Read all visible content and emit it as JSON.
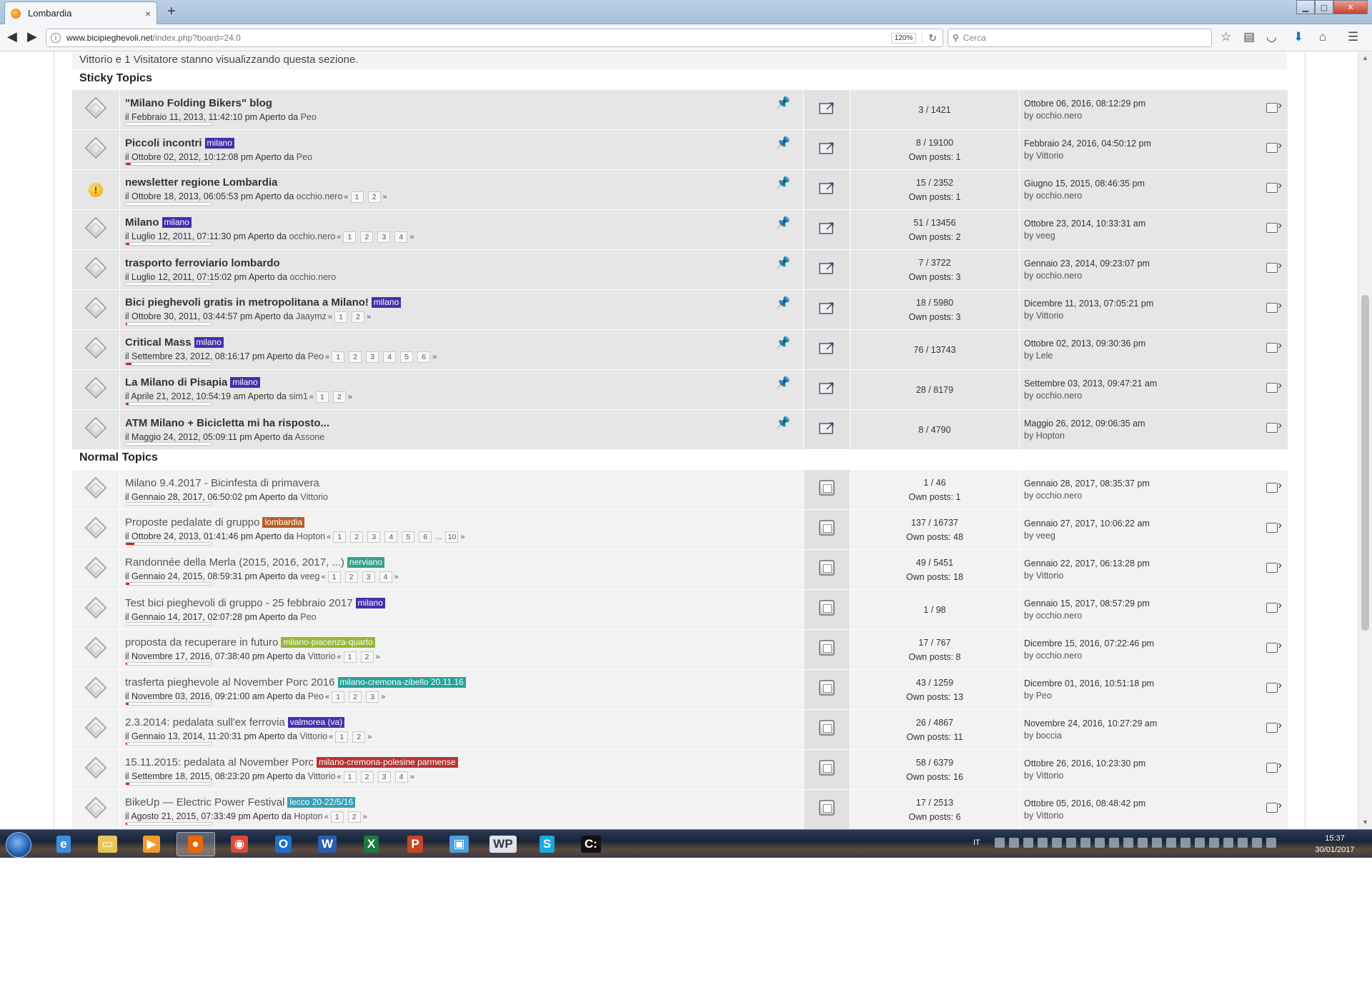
{
  "browser": {
    "tab_title": "Lombardia",
    "tab_close": "×",
    "new_tab": "+",
    "url_domain": "www.bicipieghevoli.net",
    "url_path": "/index.php?board=24.0",
    "zoom": "120%",
    "search_placeholder": "Cerca"
  },
  "viewers": "Vittorio e 1 Visitatore stanno visualizzando questa sezione.",
  "sticky_header": "Sticky Topics",
  "normal_header": "Normal Topics",
  "sticky": [
    {
      "title": "\"Milano Folding Bikers\" blog",
      "tag": "",
      "tag_color": "",
      "meta_date": "il Febbraio 11, 2013, 11:42:10 pm",
      "meta_opened": "Aperto da",
      "author": "Peo",
      "pages": [],
      "stats1": "3 / 1421",
      "stats2": "",
      "last_date": "Ottobre 06, 2016, 08:12:29 pm",
      "last_by": "by",
      "last_user": "occhio.nero",
      "progress": 0,
      "icon": "topic"
    },
    {
      "title": "Piccoli incontri",
      "tag": "milano",
      "tag_color": "#3a27a8",
      "meta_date": "il Ottobre 02, 2012, 10:12:08 pm",
      "meta_opened": "Aperto da",
      "author": "Peo",
      "pages": [],
      "stats1": "8 / 19100",
      "stats2": "Own posts: 1",
      "last_date": "Febbraio 24, 2016, 04:50:12 pm",
      "last_by": "by",
      "last_user": "Vittorio",
      "progress": 0.06,
      "icon": "topic"
    },
    {
      "title": "newsletter regione Lombardia",
      "tag": "",
      "tag_color": "",
      "meta_date": "il Ottobre 18, 2013, 06:05:53 pm",
      "meta_opened": "Aperto da",
      "author": "occhio.nero",
      "pages": [
        "1",
        "2"
      ],
      "stats1": "15 / 2352",
      "stats2": "Own posts: 1",
      "last_date": "Giugno 15, 2015, 08:46:35 pm",
      "last_by": "by",
      "last_user": "occhio.nero",
      "progress": 0,
      "icon": "warn"
    },
    {
      "title": "Milano",
      "tag": "milano",
      "tag_color": "#3a27a8",
      "meta_date": "il Luglio 12, 2011, 07:11:30 pm",
      "meta_opened": "Aperto da",
      "author": "occhio.nero",
      "pages": [
        "1",
        "2",
        "3",
        "4"
      ],
      "stats1": "51 / 13456",
      "stats2": "Own posts: 2",
      "last_date": "Ottobre 23, 2014, 10:33:31 am",
      "last_by": "by",
      "last_user": "veeg",
      "progress": 0.04,
      "icon": "topic"
    },
    {
      "title": "trasporto ferroviario lombardo",
      "tag": "",
      "tag_color": "",
      "meta_date": "il Luglio 12, 2011, 07:15:02 pm",
      "meta_opened": "Aperto da",
      "author": "occhio.nero",
      "pages": [],
      "stats1": "7 / 3722",
      "stats2": "Own posts: 3",
      "last_date": "Gennaio 23, 2014, 09:23:07 pm",
      "last_by": "by",
      "last_user": "occhio.nero",
      "progress": 0,
      "icon": "topic"
    },
    {
      "title": "Bici pieghevoli gratis in metropolitana a Milano!",
      "tag": "milano",
      "tag_color": "#3a27a8",
      "meta_date": "il Ottobre 30, 2011, 03:44:57 pm",
      "meta_opened": "Aperto da",
      "author": "Jaaymz",
      "pages": [
        "1",
        "2"
      ],
      "stats1": "18 / 5980",
      "stats2": "Own posts: 3",
      "last_date": "Dicembre 11, 2013, 07:05:21 pm",
      "last_by": "by",
      "last_user": "Vittorio",
      "progress": 0.02,
      "icon": "topic"
    },
    {
      "title": "Critical Mass",
      "tag": "milano",
      "tag_color": "#3a27a8",
      "meta_date": "il Settembre 23, 2012, 08:16:17 pm",
      "meta_opened": "Aperto da",
      "author": "Peo",
      "pages": [
        "1",
        "2",
        "3",
        "4",
        "5",
        "6"
      ],
      "stats1": "76 / 13743",
      "stats2": "",
      "last_date": "Ottobre 02, 2013, 09:30:36 pm",
      "last_by": "by",
      "last_user": "Lele",
      "progress": 0.07,
      "icon": "topic"
    },
    {
      "title": "La Milano di Pisapia",
      "tag": "milano",
      "tag_color": "#3a27a8",
      "meta_date": "il Aprile 21, 2012, 10:54:19 am",
      "meta_opened": "Aperto da",
      "author": "sim1",
      "pages": [
        "1",
        "2"
      ],
      "stats1": "28 / 8179",
      "stats2": "",
      "last_date": "Settembre 03, 2013, 09:47:21 am",
      "last_by": "by",
      "last_user": "occhio.nero",
      "progress": 0.03,
      "icon": "topic"
    },
    {
      "title": "ATM Milano + Bicicletta mi ha risposto...",
      "tag": "",
      "tag_color": "",
      "meta_date": "il Maggio 24, 2012, 05:09:11 pm",
      "meta_opened": "Aperto da",
      "author": "Assone",
      "pages": [],
      "stats1": "8 / 4790",
      "stats2": "",
      "last_date": "Maggio 26, 2012, 09:06:35 am",
      "last_by": "by",
      "last_user": "Hopton",
      "progress": 0,
      "icon": "topic"
    }
  ],
  "normal": [
    {
      "title": "Milano 9.4.2017 - Bicinfesta di primavera",
      "tag": "",
      "tag_color": "",
      "meta_date": "il Gennaio 28, 2017, 06:50:02 pm",
      "meta_opened": "Aperto da",
      "author": "Vittorio",
      "pages": [],
      "stats1": "1 / 46",
      "stats2": "Own posts: 1",
      "last_date": "Gennaio 28, 2017, 08:35:37 pm",
      "last_by": "by",
      "last_user": "occhio.nero",
      "progress": 0
    },
    {
      "title": "Proposte pedalate di gruppo",
      "tag": "lombardia",
      "tag_color": "#b5581f",
      "meta_date": "il Ottobre 24, 2013, 01:41:46 pm",
      "meta_opened": "Aperto da",
      "author": "Hopton",
      "pages": [
        "1",
        "2",
        "3",
        "4",
        "5",
        "6",
        "...",
        "10"
      ],
      "stats1": "137 / 16737",
      "stats2": "Own posts: 48",
      "last_date": "Gennaio 27, 2017, 10:06:22 am",
      "last_by": "by",
      "last_user": "veeg",
      "progress": 0.1
    },
    {
      "title": "Randonnée della Merla (2015, 2016, 2017, ...)",
      "tag": "nerviano",
      "tag_color": "#2a9d8a",
      "meta_date": "il Gennaio 24, 2015, 08:59:31 pm",
      "meta_opened": "Aperto da",
      "author": "veeg",
      "pages": [
        "1",
        "2",
        "3",
        "4"
      ],
      "stats1": "49 / 5451",
      "stats2": "Own posts: 18",
      "last_date": "Gennaio 22, 2017, 06:13:28 pm",
      "last_by": "by",
      "last_user": "Vittorio",
      "progress": 0.04
    },
    {
      "title": "Test bici pieghevoli di gruppo - 25 febbraio 2017",
      "tag": "milano",
      "tag_color": "#3a27a8",
      "meta_date": "il Gennaio 14, 2017, 02:07:28 pm",
      "meta_opened": "Aperto da",
      "author": "Peo",
      "pages": [],
      "stats1": "1 / 98",
      "stats2": "",
      "last_date": "Gennaio 15, 2017, 08:57:29 pm",
      "last_by": "by",
      "last_user": "occhio.nero",
      "progress": 0
    },
    {
      "title": "proposta da recuperare in futuro",
      "tag": "milano-piacenza-quarto",
      "tag_color": "#8fb52a",
      "meta_date": "il Novembre 17, 2016, 07:38:40 pm",
      "meta_opened": "Aperto da",
      "author": "Vittorio",
      "pages": [
        "1",
        "2"
      ],
      "stats1": "17 / 767",
      "stats2": "Own posts: 8",
      "last_date": "Dicembre 15, 2016, 07:22:46 pm",
      "last_by": "by",
      "last_user": "occhio.nero",
      "progress": 0.02
    },
    {
      "title": "trasferta pieghevole al November Porc 2016",
      "tag": "milano-cremona-zibello 20.11.16",
      "tag_color": "#1f9d96",
      "meta_date": "il Novembre 03, 2016, 09:21:00 am",
      "meta_opened": "Aperto da",
      "author": "Peo",
      "pages": [
        "1",
        "2",
        "3"
      ],
      "stats1": "43 / 1259",
      "stats2": "Own posts: 13",
      "last_date": "Dicembre 01, 2016, 10:51:18 pm",
      "last_by": "by",
      "last_user": "Peo",
      "progress": 0.03
    },
    {
      "title": "2.3.2014: pedalata sull'ex ferrovia",
      "tag": "valmorea (va)",
      "tag_color": "#3a27a8",
      "meta_date": "il Gennaio 13, 2014, 11:20:31 pm",
      "meta_opened": "Aperto da",
      "author": "Vittorio",
      "pages": [
        "1",
        "2"
      ],
      "stats1": "26 / 4867",
      "stats2": "Own posts: 11",
      "last_date": "Novembre 24, 2016, 10:27:29 am",
      "last_by": "by",
      "last_user": "boccia",
      "progress": 0.02
    },
    {
      "title": "15.11.2015: pedalata al November Porc",
      "tag": "milano-cremona-polesine parmense",
      "tag_color": "#b22a2a",
      "meta_date": "il Settembre 18, 2015, 08:23:20 pm",
      "meta_opened": "Aperto da",
      "author": "Vittorio",
      "pages": [
        "1",
        "2",
        "3",
        "4"
      ],
      "stats1": "58 / 6379",
      "stats2": "Own posts: 16",
      "last_date": "Ottobre 26, 2016, 10:23:30 pm",
      "last_by": "by",
      "last_user": "Vittorio",
      "progress": 0.04
    },
    {
      "title": "BikeUp — Electric Power Festival",
      "tag": "lecco 20-22/5/16",
      "tag_color": "#2a9db5",
      "meta_date": "il Agosto 21, 2015, 07:33:49 pm",
      "meta_opened": "Aperto da",
      "author": "Hopton",
      "pages": [
        "1",
        "2"
      ],
      "stats1": "17 / 2513",
      "stats2": "Own posts: 6",
      "last_date": "Ottobre 05, 2016, 08:48:42 pm",
      "last_by": "by",
      "last_user": "Vittorio",
      "progress": 0.02
    }
  ],
  "taskbar": {
    "language": "IT",
    "time": "15:37",
    "date": "30/01/2017",
    "apps": [
      "internet-explorer",
      "file-explorer",
      "media-player",
      "firefox",
      "chrome",
      "outlook",
      "word",
      "excel",
      "powerpoint",
      "remote-desktop",
      "wordpress",
      "skype",
      "command-prompt"
    ]
  }
}
